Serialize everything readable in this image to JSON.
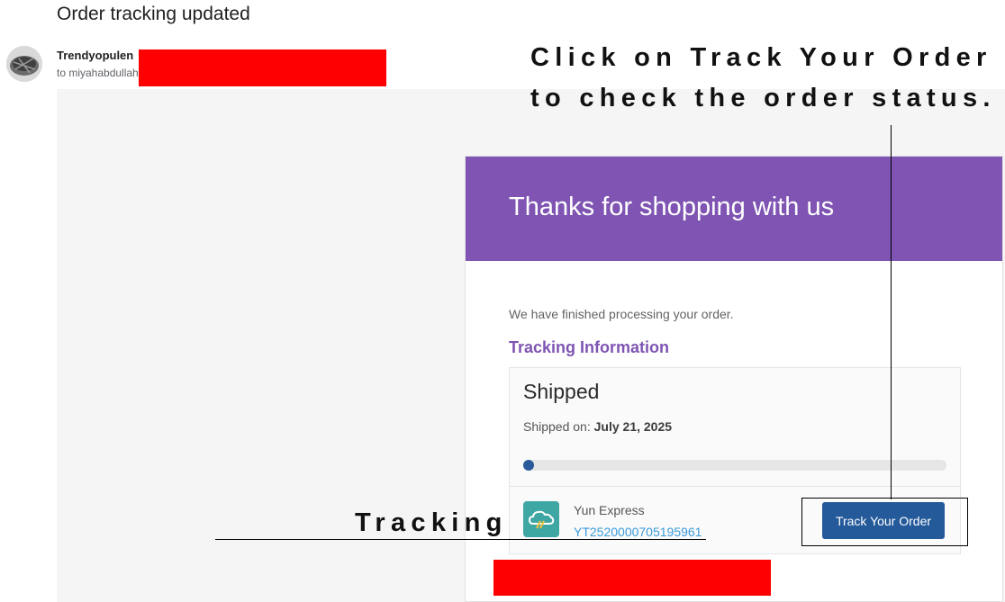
{
  "email": {
    "subject": "Order tracking updated",
    "sender": "Trendyopulen",
    "recipient": "to miyahabdullah"
  },
  "card": {
    "header_title": "Thanks for shopping with us",
    "intro": "We have finished processing your order.",
    "tracking_heading": "Tracking Information",
    "status": "Shipped",
    "shipped_on_label": "Shipped on:",
    "shipped_on_date": "July 21, 2025",
    "progress": 0.02,
    "carrier": "Yun Express",
    "tracking_number": "YT2520000705195961",
    "track_button": "Track Your Order"
  },
  "annotations": {
    "line1": "Click on Track Your Order",
    "line2": "to check the order status.",
    "tracking": "Tracking"
  },
  "colors": {
    "brand_purple": "#7f54b3",
    "button_blue": "#24599a",
    "link_blue": "#3a9ad9",
    "redaction": "#ff0000"
  },
  "icons": {
    "avatar": "avatar-icon",
    "carrier": "cloud-truck-icon"
  }
}
